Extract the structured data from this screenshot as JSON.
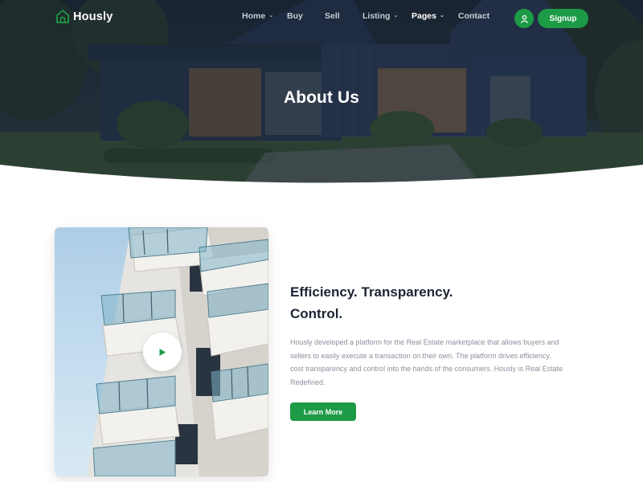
{
  "brand": {
    "name": "Hously",
    "logo_icon": "house-icon",
    "accent_color": "#1d9a45"
  },
  "nav": {
    "items": [
      {
        "label": "Home",
        "has_dropdown": true
      },
      {
        "label": "Buy",
        "has_dropdown": false
      },
      {
        "label": "Sell",
        "has_dropdown": false
      },
      {
        "label": "Listing",
        "has_dropdown": true
      },
      {
        "label": "Pages",
        "has_dropdown": true,
        "active": true
      },
      {
        "label": "Contact",
        "has_dropdown": false
      }
    ],
    "dropdown_icon": "chevron-down-icon"
  },
  "header_actions": {
    "user_icon": "user-icon",
    "signup_label": "Signup"
  },
  "hero": {
    "title": "About Us"
  },
  "about": {
    "headline_line1": "Efficiency. Transparency.",
    "headline_line2": "Control.",
    "body": "Hously developed a platform for the Real Estate marketplace that allows buyers and sellers to easily execute a transaction on their own. The platform drives efficiency, cost transparency and control into the hands of the consumers. Hously is Real Estate Redefined.",
    "cta_label": "Learn More",
    "play_icon": "play-icon"
  }
}
